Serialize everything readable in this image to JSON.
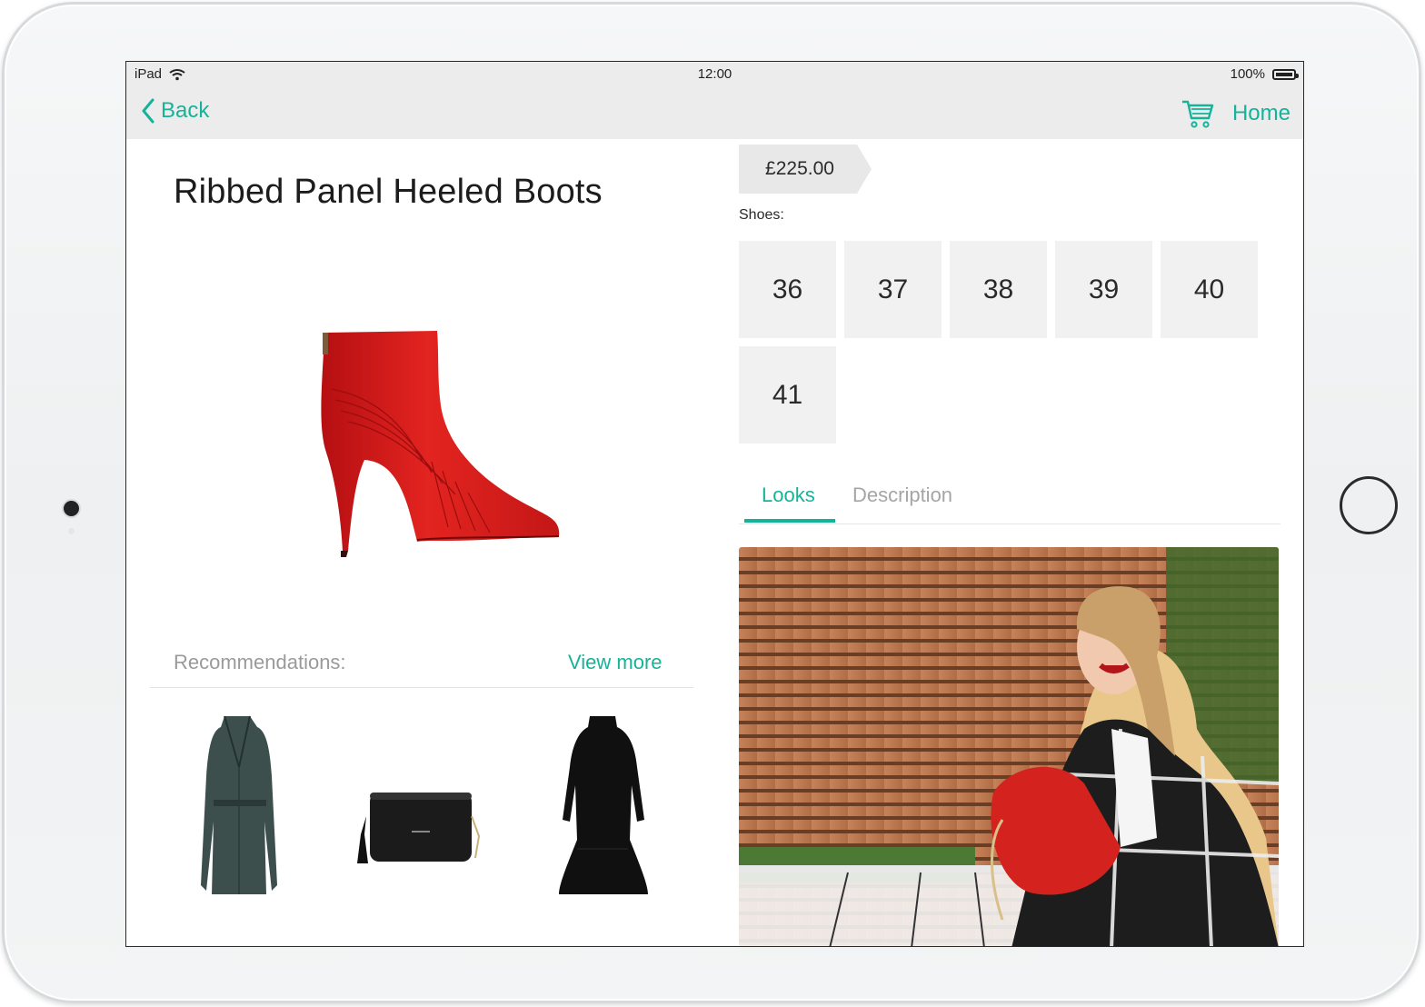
{
  "status_bar": {
    "device": "iPad",
    "time": "12:00",
    "battery": "100%"
  },
  "nav": {
    "back_label": "Back",
    "home_label": "Home"
  },
  "product": {
    "title": "Ribbed Panel Heeled Boots",
    "price": "£225.00",
    "size_category_label": "Shoes:",
    "sizes": [
      "36",
      "37",
      "38",
      "39",
      "40",
      "41"
    ]
  },
  "recommendations": {
    "label": "Recommendations:",
    "view_more_label": "View more",
    "items": [
      "coat",
      "handbag",
      "dress"
    ]
  },
  "tabs": [
    {
      "label": "Looks",
      "active": true
    },
    {
      "label": "Description",
      "active": false
    }
  ],
  "colors": {
    "accent": "#14b39a",
    "nav_bg": "#ececec",
    "tile_bg": "#f1f1f1",
    "boot_red": "#d91b1b"
  },
  "icons": {
    "back": "chevron-left-icon",
    "cart": "shopping-cart-icon",
    "wifi": "wifi-icon",
    "battery": "battery-icon"
  }
}
